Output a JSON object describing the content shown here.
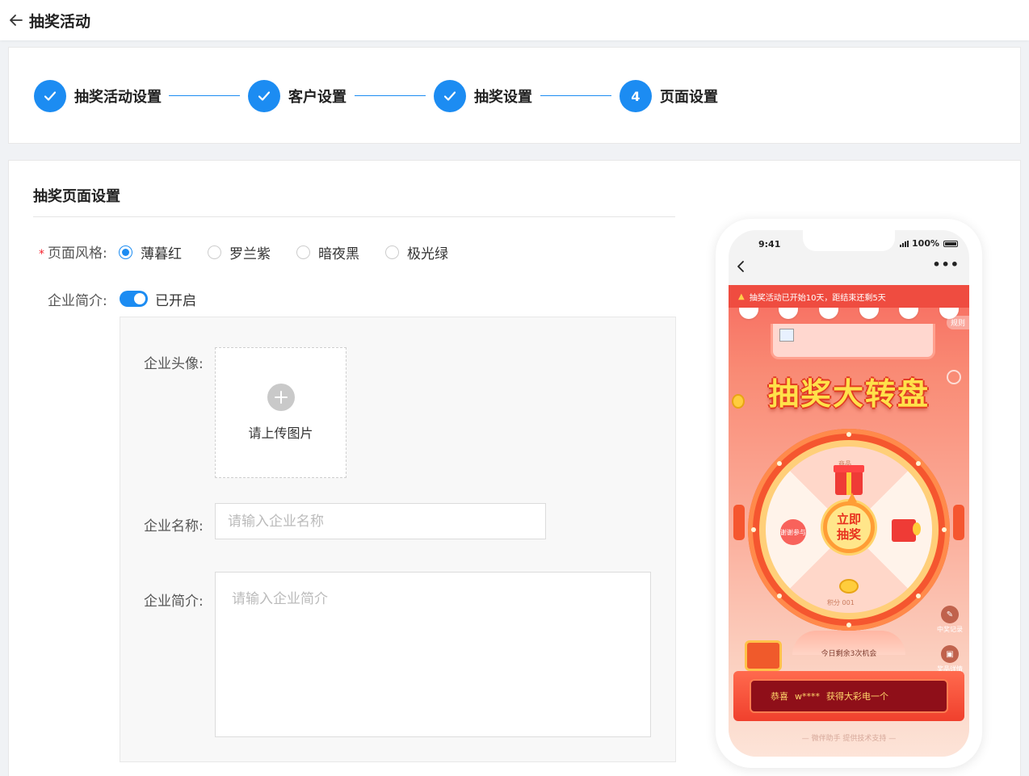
{
  "header": {
    "title": "抽奖活动"
  },
  "steps": [
    {
      "label": "抽奖活动设置",
      "status": "done"
    },
    {
      "label": "客户设置",
      "status": "done"
    },
    {
      "label": "抽奖设置",
      "status": "done"
    },
    {
      "label": "页面设置",
      "status": "current",
      "number": "4"
    }
  ],
  "section": {
    "title": "抽奖页面设置"
  },
  "form": {
    "style_label": "页面风格:",
    "style_options": [
      "薄暮红",
      "罗兰紫",
      "暗夜黑",
      "极光绿"
    ],
    "style_selected": "薄暮红",
    "intro_label": "企业简介:",
    "intro_switch_text": "已开启",
    "avatar_label": "企业头像:",
    "upload_text": "请上传图片",
    "name_label": "企业名称:",
    "name_placeholder": "请输入企业名称",
    "desc_label": "企业简介:",
    "desc_placeholder": "请输入企业简介"
  },
  "preview": {
    "time": "9:41",
    "battery": "100%",
    "more": "•••",
    "notice": "抽奖活动已开始10天，距结束还剩5天",
    "rules": "规则",
    "title": "抽奖大转盘",
    "draw_button": [
      "立即",
      "抽奖"
    ],
    "prize_top": "商品",
    "prize_left": "谢谢参与",
    "prize_bottom": "积分 001",
    "chances": "今日剩余3次机会",
    "side_buttons": [
      "中奖记录",
      "奖品详情"
    ],
    "winner_prefix": "恭喜",
    "winner_name": "w****",
    "winner_suffix": "获得大彩电一个",
    "footer": "— 微伴助手  提供技术支持 —"
  },
  "colors": {
    "primary": "#1c8cf2",
    "theme_red": "#ef4c40"
  }
}
